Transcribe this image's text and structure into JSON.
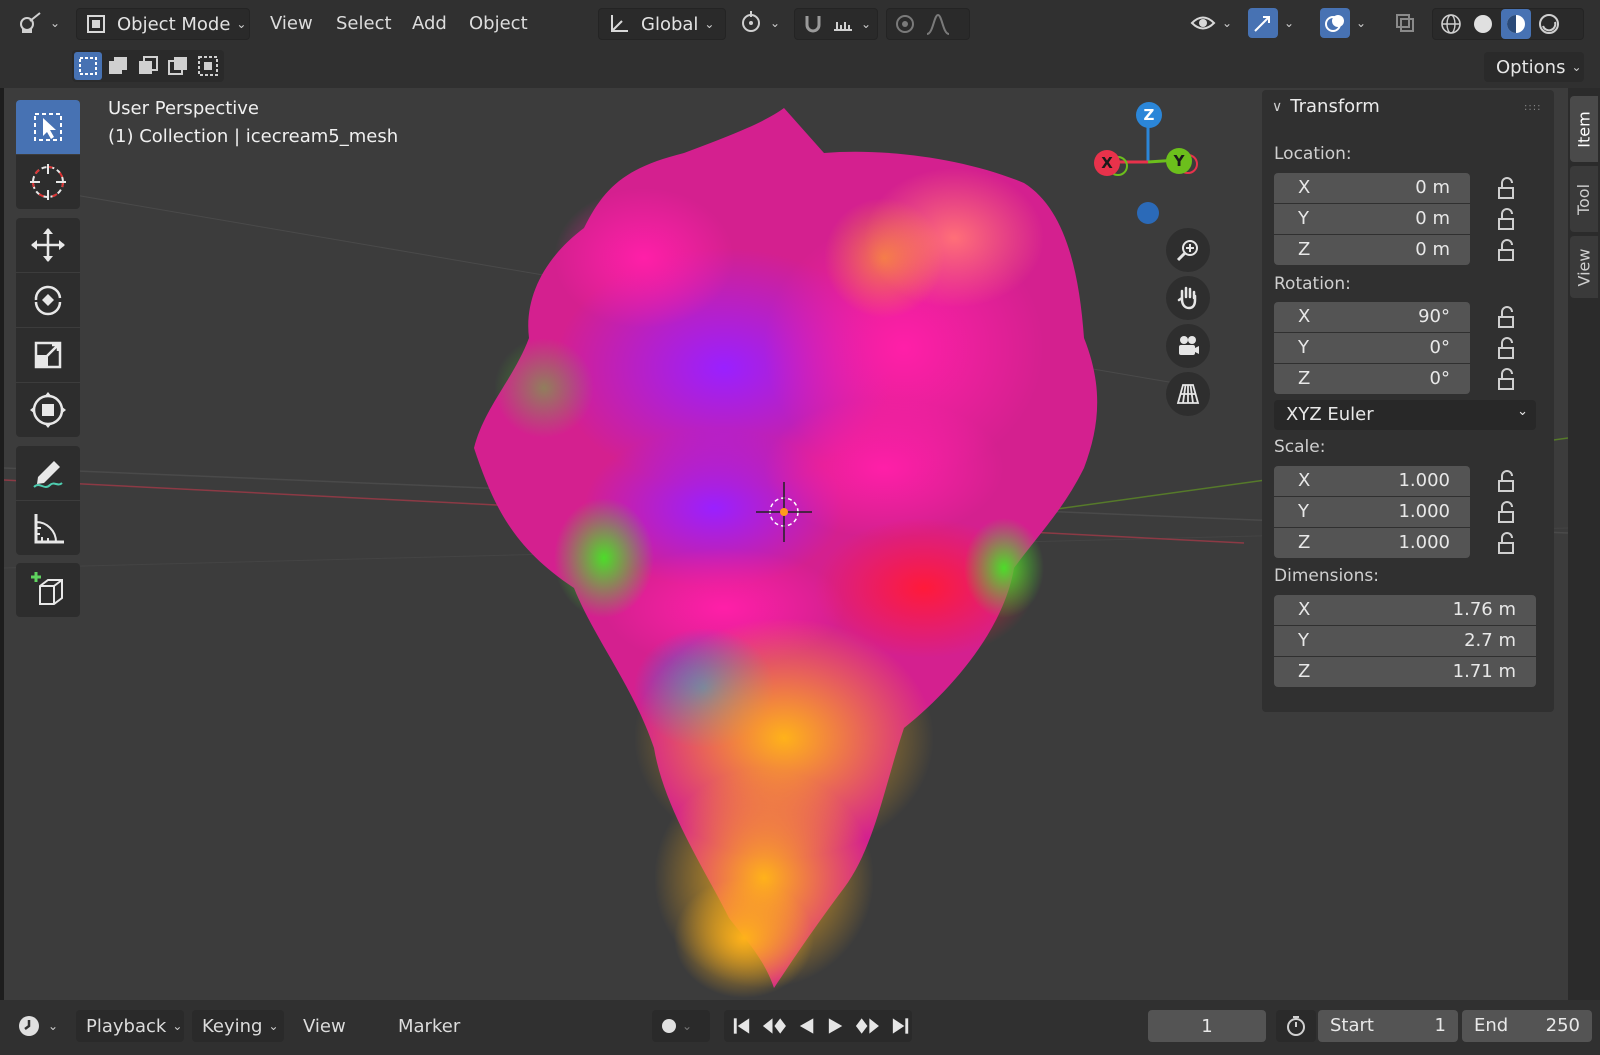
{
  "header": {
    "mode_label": "Object Mode",
    "menus": [
      "View",
      "Select",
      "Add",
      "Object"
    ],
    "orientation_label": "Global"
  },
  "toolsettings": {
    "options_label": "Options"
  },
  "viewport": {
    "perspective_label": "User Perspective",
    "collection_label": "(1) Collection | icecream5_mesh",
    "gizmo": {
      "x": "X",
      "y": "Y",
      "z": "Z"
    }
  },
  "sidebar_tabs": [
    "Item",
    "Tool",
    "View"
  ],
  "transform": {
    "title": "Transform",
    "location_label": "Location:",
    "location": [
      {
        "axis": "X",
        "value": "0 m"
      },
      {
        "axis": "Y",
        "value": "0 m"
      },
      {
        "axis": "Z",
        "value": "0 m"
      }
    ],
    "rotation_label": "Rotation:",
    "rotation": [
      {
        "axis": "X",
        "value": "90°"
      },
      {
        "axis": "Y",
        "value": "0°"
      },
      {
        "axis": "Z",
        "value": "0°"
      }
    ],
    "rotation_mode": "XYZ Euler",
    "scale_label": "Scale:",
    "scale": [
      {
        "axis": "X",
        "value": "1.000"
      },
      {
        "axis": "Y",
        "value": "1.000"
      },
      {
        "axis": "Z",
        "value": "1.000"
      }
    ],
    "dimensions_label": "Dimensions:",
    "dimensions": [
      {
        "axis": "X",
        "value": "1.76 m"
      },
      {
        "axis": "Y",
        "value": "2.7 m"
      },
      {
        "axis": "Z",
        "value": "1.71 m"
      }
    ]
  },
  "timeline": {
    "playback_label": "Playback",
    "keying_label": "Keying",
    "view_label": "View",
    "marker_label": "Marker",
    "current_frame": "1",
    "start_label": "Start",
    "start_value": "1",
    "end_label": "End",
    "end_value": "250"
  },
  "colors": {
    "accent": "#4772b3",
    "axis_x": "#e8324b",
    "axis_y": "#6cbf1c",
    "axis_z": "#2b86d8"
  }
}
